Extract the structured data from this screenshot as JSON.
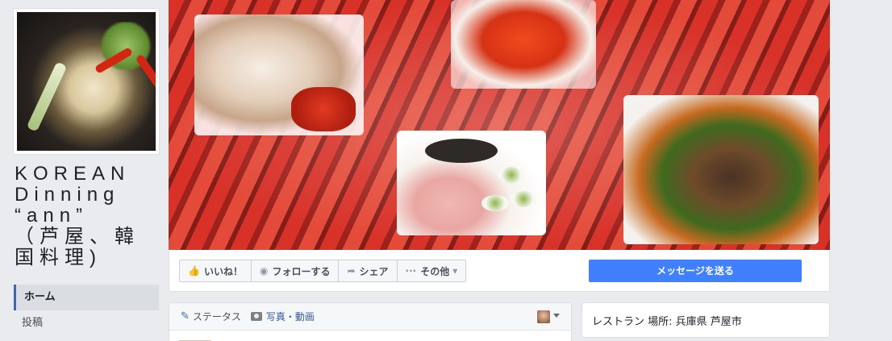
{
  "page": {
    "name": "KOREAN Dinning “ann” （芦屋、韓国料理)"
  },
  "nav": {
    "items": [
      {
        "label": "ホーム",
        "active": true
      },
      {
        "label": "投稿",
        "active": false
      }
    ]
  },
  "actions": {
    "like": {
      "label": "いいね！",
      "icon": "thumbs-up-icon"
    },
    "follow": {
      "label": "フォローする",
      "icon": "rss-icon"
    },
    "share": {
      "label": "シェア",
      "icon": "share-arrow-icon"
    },
    "more": {
      "label": "その他",
      "icon": "ellipsis-icon"
    },
    "message": {
      "label": "メッセージを送る"
    }
  },
  "composer": {
    "status_label": "ステータス",
    "photo_label": "写真・動画"
  },
  "info": {
    "text": "レストラン 場所: 兵庫県 芦屋市"
  },
  "colors": {
    "accent": "#4267b2",
    "message_button": "#4080ff",
    "background": "#e9ebee"
  }
}
